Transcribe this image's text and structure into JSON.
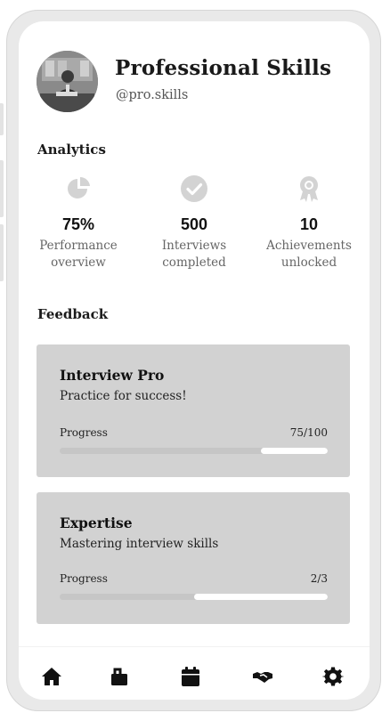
{
  "profile": {
    "name": "Professional Skills",
    "handle": "@pro.skills"
  },
  "analytics": {
    "heading": "Analytics",
    "stats": [
      {
        "icon": "pie-chart-icon",
        "value": "75%",
        "label_line1": "Performance",
        "label_line2": "overview"
      },
      {
        "icon": "check-circle-icon",
        "value": "500",
        "label_line1": "Interviews",
        "label_line2": "completed"
      },
      {
        "icon": "award-icon",
        "value": "10",
        "label_line1": "Achievements",
        "label_line2": "unlocked"
      }
    ]
  },
  "feedback": {
    "heading": "Feedback",
    "cards": [
      {
        "title": "Interview Pro",
        "subtitle": "Practice for success!",
        "progress_label": "Progress",
        "progress_text": "75/100",
        "progress_fraction": 0.75
      },
      {
        "title": "Expertise",
        "subtitle": "Mastering interview skills",
        "progress_label": "Progress",
        "progress_text": "2/3",
        "progress_fraction": 0.5
      }
    ]
  },
  "nav": {
    "items": [
      {
        "icon": "home-icon",
        "active": true
      },
      {
        "icon": "briefcase-icon",
        "active": false
      },
      {
        "icon": "calendar-icon",
        "active": false
      },
      {
        "icon": "handshake-icon",
        "active": false
      },
      {
        "icon": "settings-icon",
        "active": false
      }
    ]
  },
  "colors": {
    "card_background": "#d2d2d2",
    "progress_track": "#ffffff",
    "progress_fill": "#c6c6c6",
    "icon_muted": "#d3d3d3",
    "text_primary": "#111111"
  }
}
